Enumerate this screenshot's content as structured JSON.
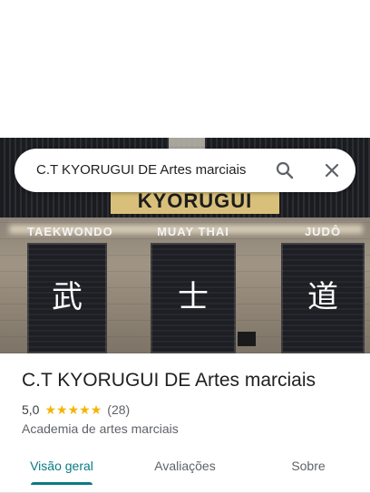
{
  "search": {
    "query": "C.T KYORUGUI DE Artes marciais",
    "search_icon": "search-icon",
    "close_icon": "close-icon"
  },
  "photo": {
    "sign_text": "KYORUGUI",
    "doors": [
      {
        "label": "TAEKWONDO",
        "kanji": "武"
      },
      {
        "label": "MUAY THAI",
        "kanji": "士"
      },
      {
        "label": "JUDÔ",
        "kanji": "道"
      }
    ]
  },
  "place": {
    "name": "C.T KYORUGUI DE Artes marciais",
    "rating": "5,0",
    "stars": 5,
    "review_count": "(28)",
    "category": "Academia de artes marciais"
  },
  "tabs": [
    {
      "label": "Visão geral",
      "active": true
    },
    {
      "label": "Avaliações",
      "active": false
    },
    {
      "label": "Sobre",
      "active": false
    }
  ],
  "colors": {
    "accent": "#0a7b83",
    "star": "#f4b400"
  }
}
